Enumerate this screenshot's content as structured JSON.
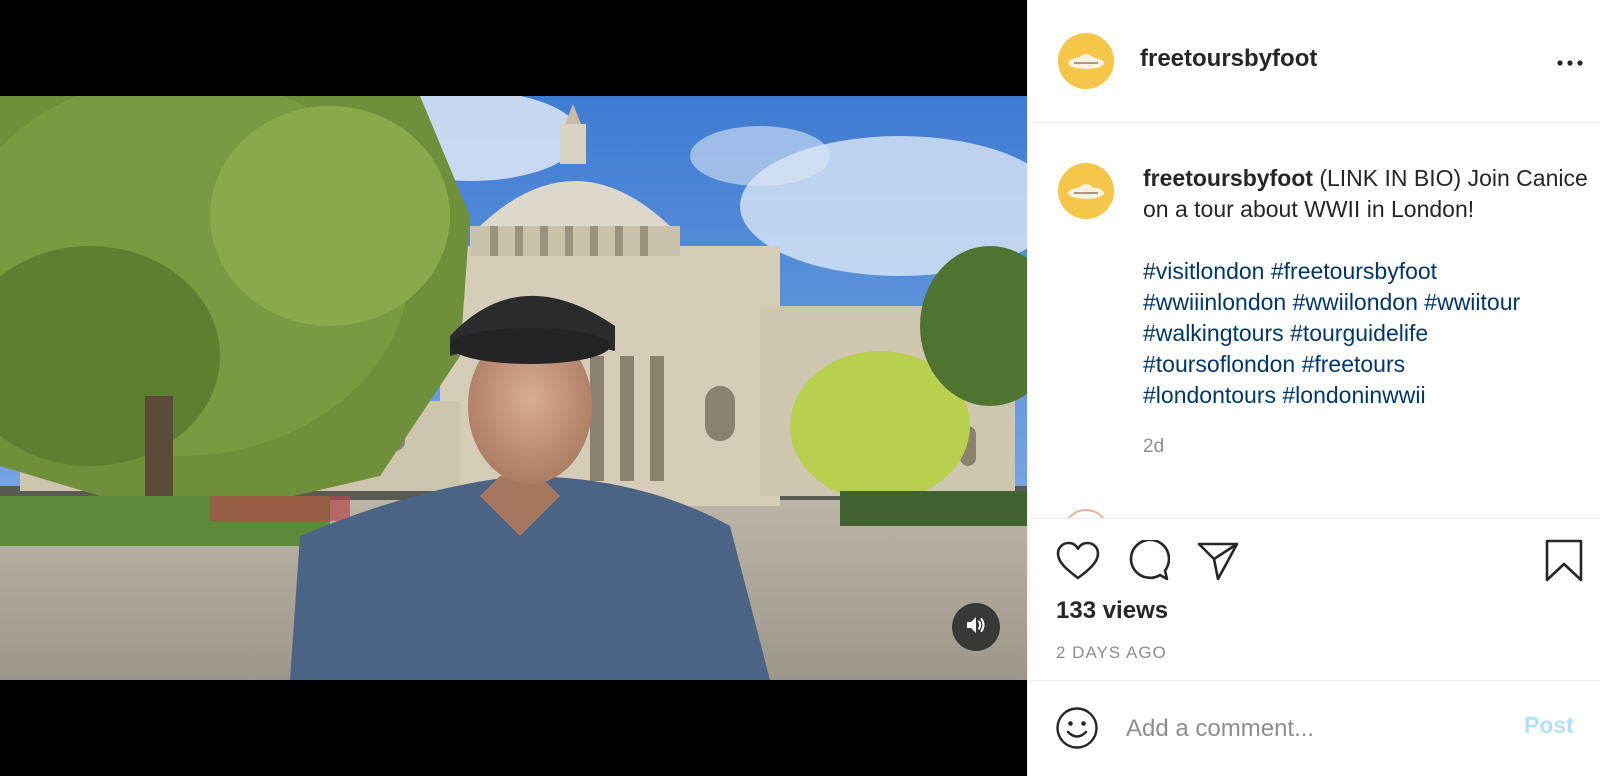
{
  "post": {
    "username": "freetoursbyfoot",
    "caption_user": "freetoursbyfoot",
    "caption_text": "(LINK IN BIO) Join Canice on a tour about WWII in London!",
    "hashtags": [
      "#visitlondon",
      "#freetoursbyfoot",
      "#wwiiinlondon",
      "#wwiilondon",
      "#wwiitour",
      "#walkingtours",
      "#tourguidelife",
      "#toursoflondon",
      "#freetours",
      "#londontours",
      "#londoninwwii"
    ],
    "time_ago": "2d",
    "views": "133 views",
    "date": "2 DAYS AGO"
  },
  "comment": {
    "placeholder": "Add a comment...",
    "post_label": "Post"
  },
  "icons": {
    "more": "more-options-icon",
    "like": "heart-icon",
    "comment": "comment-icon",
    "share": "paper-plane-icon",
    "save": "bookmark-icon",
    "sound": "speaker-icon",
    "emoji": "emoji-icon"
  },
  "colors": {
    "hashtag": "#00376b",
    "post_disabled": "#b2dffc",
    "avatar": "#f4c64a"
  }
}
